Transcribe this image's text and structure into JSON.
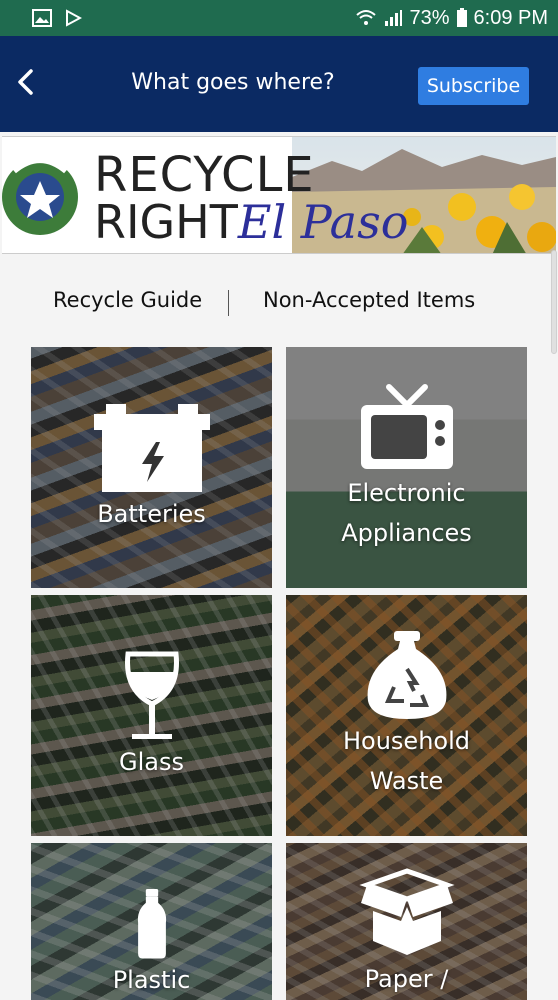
{
  "status_bar": {
    "battery_percent": "73%",
    "time": "6:09 PM",
    "icons": [
      "gallery-icon",
      "play-store-icon",
      "wifi-icon",
      "signal-icon",
      "battery-icon"
    ]
  },
  "header": {
    "title": "What goes where?",
    "subscribe_label": "Subscribe",
    "back_icon": "chevron-left-icon"
  },
  "banner": {
    "line1": "RECYCLE",
    "line2_main": "RIGHT",
    "line2_script": "El Paso"
  },
  "tabs": {
    "recycle_guide": "Recycle Guide",
    "non_accepted": "Non-Accepted Items"
  },
  "categories": [
    {
      "label_lines": [
        "Batteries"
      ],
      "icon": "battery-icon"
    },
    {
      "label_lines": [
        "Electronic",
        "Appliances"
      ],
      "icon": "tv-icon"
    },
    {
      "label_lines": [
        "Glass"
      ],
      "icon": "wine-glass-icon"
    },
    {
      "label_lines": [
        "Household",
        "Waste"
      ],
      "icon": "recycle-bag-icon"
    },
    {
      "label_lines": [
        "Plastic"
      ],
      "icon": "plastic-bottle-icon"
    },
    {
      "label_lines": [
        "Paper /"
      ],
      "icon": "open-box-icon"
    }
  ],
  "colors": {
    "status_bar": "#1f6b4f",
    "header": "#0b2a63",
    "subscribe": "#2f7de1"
  }
}
